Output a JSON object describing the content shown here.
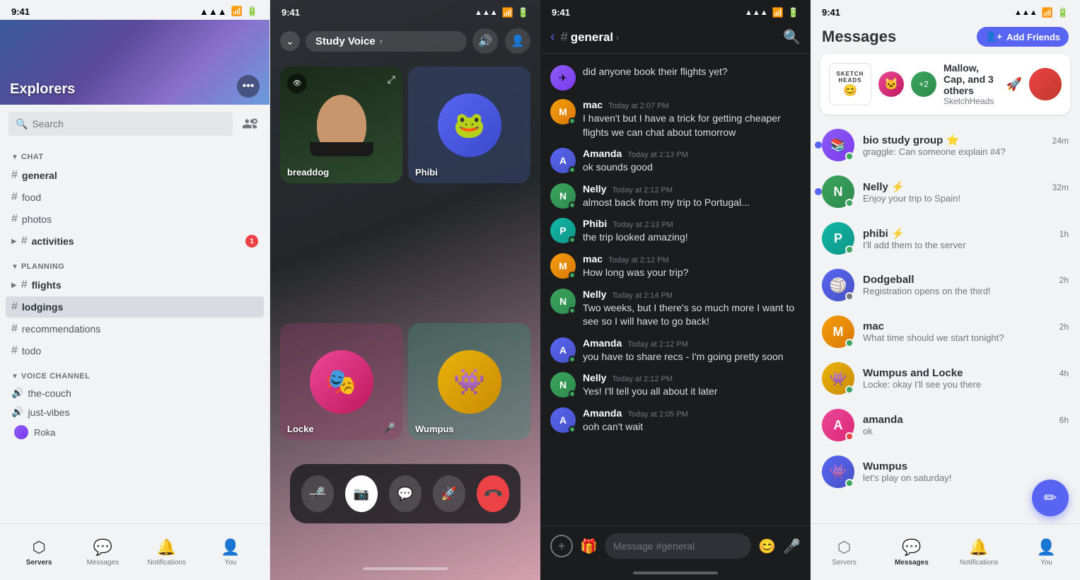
{
  "panel1": {
    "statusBar": {
      "time": "9:41",
      "signal": "●●●▫",
      "wifi": "WiFi",
      "battery": "■■■"
    },
    "serverName": "Explorers",
    "search": {
      "placeholder": "Search"
    },
    "addFriendLabel": "+",
    "sections": {
      "chat": {
        "label": "CHAT",
        "channels": [
          {
            "name": "general",
            "bold": true
          },
          {
            "name": "food",
            "bold": false
          },
          {
            "name": "photos",
            "bold": false
          },
          {
            "name": "activities",
            "bold": true,
            "badge": "1"
          }
        ]
      },
      "planning": {
        "label": "PLANNING",
        "channels": [
          {
            "name": "flights",
            "bold": true,
            "expanded": false
          },
          {
            "name": "lodgings",
            "bold": false,
            "active": true
          },
          {
            "name": "recommendations",
            "bold": false
          },
          {
            "name": "todo",
            "bold": false
          }
        ]
      },
      "voiceChannel": {
        "label": "VOICE CHANNEL",
        "channels": [
          {
            "name": "the-couch"
          },
          {
            "name": "just-vibes"
          }
        ],
        "members": [
          "Roka"
        ]
      }
    },
    "bottomNav": [
      {
        "id": "servers",
        "label": "Servers",
        "active": true
      },
      {
        "id": "messages",
        "label": "Messages",
        "active": false
      },
      {
        "id": "notifications",
        "label": "Notifications",
        "active": false
      },
      {
        "id": "you",
        "label": "You",
        "active": false
      }
    ]
  },
  "panel2": {
    "statusBar": {
      "time": "9:41"
    },
    "channelName": "Study Voice",
    "participants": [
      {
        "id": "breaddog",
        "name": "breaddog",
        "type": "video"
      },
      {
        "id": "phibi",
        "name": "Phibi",
        "type": "avatar",
        "color": "blue"
      },
      {
        "id": "locke",
        "name": "Locke",
        "type": "avatar",
        "color": "pink",
        "muted": true
      },
      {
        "id": "wumpus",
        "name": "Wumpus",
        "type": "avatar",
        "color": "teal"
      }
    ],
    "controls": [
      {
        "id": "mute",
        "icon": "🎤",
        "type": "dark"
      },
      {
        "id": "camera",
        "icon": "📷",
        "type": "white"
      },
      {
        "id": "chat",
        "icon": "💬",
        "type": "dark"
      },
      {
        "id": "screenshare",
        "icon": "🚀",
        "type": "dark"
      },
      {
        "id": "hangup",
        "icon": "📞",
        "type": "red"
      }
    ]
  },
  "panel3": {
    "statusBar": {
      "time": "9:41"
    },
    "channelName": "general",
    "messages": [
      {
        "author": null,
        "text": "did anyone book their flights yet?",
        "avatarColor": "purple",
        "time": null,
        "continuation": true
      },
      {
        "author": "mac",
        "text": "I haven't but I have a trick for getting cheaper flights we can chat about tomorrow",
        "time": "Today at 2:07 PM",
        "avatarColor": "orange"
      },
      {
        "author": "Amanda",
        "text": "ok sounds good",
        "time": "Today at 2:13 PM",
        "avatarColor": "blue"
      },
      {
        "author": "Nelly",
        "text": "almost back from my trip to Portugal...",
        "time": "Today at 2:12 PM",
        "avatarColor": "green"
      },
      {
        "author": "Phibi",
        "text": "the trip looked amazing!",
        "time": "Today at 2:13 PM",
        "avatarColor": "teal"
      },
      {
        "author": "mac",
        "text": "How long was your trip?",
        "time": "Today at 2:12 PM",
        "avatarColor": "orange"
      },
      {
        "author": "Nelly",
        "text": "Two weeks, but I there's so much more I want to see so I will have to go back!",
        "time": "Today at 2:14 PM",
        "avatarColor": "green"
      },
      {
        "author": "Amanda",
        "text": "you have to share recs - I'm going pretty soon",
        "time": "Today at 2:12 PM",
        "avatarColor": "blue"
      },
      {
        "author": "Nelly",
        "text": "Yes! I'll tell you all about it later",
        "time": "Today at 2:12 PM",
        "avatarColor": "green"
      },
      {
        "author": "Amanda",
        "text": "ooh can't wait",
        "time": "Today at 2:05 PM",
        "avatarColor": "blue"
      }
    ],
    "inputPlaceholder": "Message #general"
  },
  "panel4": {
    "statusBar": {
      "time": "9:41"
    },
    "title": "Messages",
    "addFriendsLabel": "Add Friends",
    "featured": {
      "name": "Mallow, Cap, and 3 others",
      "sub": "SketchHeads",
      "rocket": "🚀"
    },
    "dms": [
      {
        "name": "bio study group ⭐",
        "preview": "graggle: Can someone explain #4?",
        "time": "24m",
        "statusColor": "green",
        "unread": true,
        "avatarColor": "purple"
      },
      {
        "name": "Nelly ⚡",
        "preview": "Enjoy your trip to Spain!",
        "time": "32m",
        "statusColor": "green",
        "unread": true,
        "avatarColor": "green"
      },
      {
        "name": "phibi ⚡",
        "preview": "I'll add them to the server",
        "time": "1h",
        "statusColor": "green",
        "unread": false,
        "avatarColor": "teal"
      },
      {
        "name": "Dodgeball",
        "preview": "Registration opens on the third!",
        "time": "2h",
        "statusColor": "gray",
        "unread": false,
        "avatarColor": "blue"
      },
      {
        "name": "mac",
        "preview": "What time should we start tonight?",
        "time": "2h",
        "statusColor": "green",
        "unread": false,
        "avatarColor": "orange"
      },
      {
        "name": "Wumpus and Locke",
        "preview": "Locke: okay I'll see you there",
        "time": "4h",
        "statusColor": "green",
        "unread": false,
        "avatarColor": "yellow"
      },
      {
        "name": "amanda",
        "preview": "ok",
        "time": "6h",
        "statusColor": "red",
        "unread": false,
        "avatarColor": "pink"
      },
      {
        "name": "Wumpus",
        "preview": "let's play on saturday!",
        "time": "",
        "statusColor": "green",
        "unread": false,
        "avatarColor": "blue"
      }
    ],
    "bottomNav": [
      {
        "id": "servers",
        "label": "Servers",
        "active": false
      },
      {
        "id": "messages",
        "label": "Messages",
        "active": true
      },
      {
        "id": "notifications",
        "label": "Notifications",
        "active": false
      },
      {
        "id": "you",
        "label": "You",
        "active": false
      }
    ]
  }
}
